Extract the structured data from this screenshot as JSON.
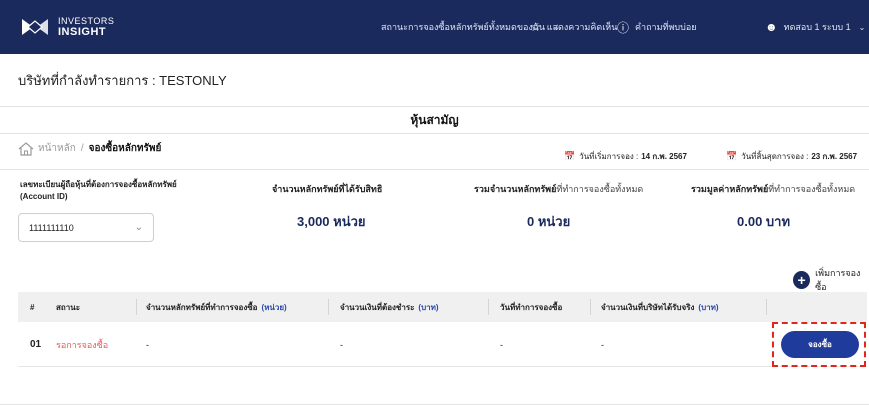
{
  "header": {
    "logo_line1": "INVESTORS",
    "logo_line2": "INSIGHT",
    "nav": {
      "status_label": "สถานะการจองซื้อหลักทรัพย์ทั้งหมดของฉัน",
      "feedback_label": "แสดงความคิดเห็น",
      "faq_label": "คำถามที่พบบ่อย",
      "user_label": "ทดสอบ 1 ระบบ 1"
    }
  },
  "company": {
    "text": "บริษัทที่กำลังทำรายการ : TESTONLY"
  },
  "section": {
    "title": "หุ้นสามัญ"
  },
  "breadcrumb": {
    "home": "หน้าหลัก",
    "separator": "/",
    "current": "จองซื้อหลักทรัพย์"
  },
  "dates": {
    "start_label": "วันที่เริ่มการจอง :",
    "start_value": "14 ก.พ. 2567",
    "end_label": "วันที่สิ้นสุดการจอง :",
    "end_value": "23 ก.พ. 2567"
  },
  "account": {
    "label": "เลขทะเบียนผู้ถือหุ้นที่ต้องการจองซื้อหลักทรัพย์ (Account ID)",
    "selected": "1111111110"
  },
  "summary": {
    "entitled_label": "จำนวนหลักทรัพย์ที่ได้รับสิทธิ",
    "entitled_value": "3,000 หน่วย",
    "reserved_label_bold": "รวมจำนวนหลักทรัพย์",
    "reserved_label_light": "ที่ทำการจองซื้อทั้งหมด",
    "reserved_value": "0 หน่วย",
    "total_label_bold": "รวมมูลค่าหลักทรัพย์",
    "total_label_light": "ที่ทำการจองซื้อทั้งหมด",
    "total_value": "0.00 บาท"
  },
  "add_button": {
    "label": "เพิ่มการจองซื้อ"
  },
  "table": {
    "headers": [
      {
        "label": "#",
        "unit": ""
      },
      {
        "label": "สถานะ",
        "unit": ""
      },
      {
        "label": "จำนวนหลักทรัพย์ที่ทำการจองซื้อ",
        "unit": "(หน่วย)"
      },
      {
        "label": "จำนวนเงินที่ต้องชำระ",
        "unit": "(บาท)"
      },
      {
        "label": "วันที่ทำการจองซื้อ",
        "unit": ""
      },
      {
        "label": "จำนวนเงินที่บริษัทได้รับจริง",
        "unit": "(บาท)"
      }
    ],
    "rows": [
      {
        "no": "01",
        "status": "รอการจองซื้อ",
        "units": "-",
        "amount": "-",
        "date": "-",
        "received": "-",
        "action": "จองซื้อ"
      }
    ]
  },
  "colors": {
    "navy": "#1b2a5c",
    "button_blue": "#1f3c9c",
    "status_red": "#e45a5a",
    "highlight_red": "#e0271b"
  }
}
